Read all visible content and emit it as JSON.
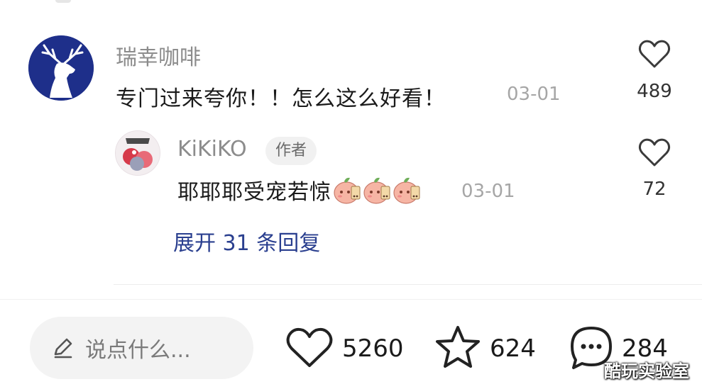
{
  "comment": {
    "username": "瑞幸咖啡",
    "text": "专门过来夸你！！怎么这么好看！",
    "date": "03-01",
    "likes": "489"
  },
  "reply": {
    "username": "KiKiKO",
    "badge": "作者",
    "text": "耶耶耶受宠若惊",
    "date": "03-01",
    "likes": "72",
    "emoji_count": 3
  },
  "expand_label": "展开 31 条回复",
  "bottom_bar": {
    "input_placeholder": "说点什么...",
    "like_count": "5260",
    "favorite_count": "624",
    "comment_count": "284"
  },
  "watermark": "酷玩实验室",
  "colors": {
    "brand_blue": "#1e2f8a",
    "link_blue": "#2a3f8f"
  }
}
